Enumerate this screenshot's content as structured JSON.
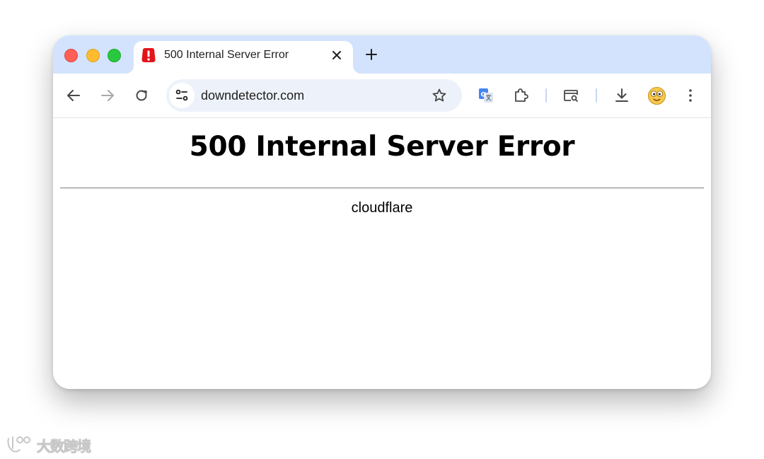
{
  "window_controls": {
    "close": "close",
    "minimize": "minimize",
    "maximize": "maximize",
    "colors": {
      "close": "#ff5f57",
      "minimize": "#febc2e",
      "maximize": "#28c840"
    }
  },
  "tab": {
    "title": "500 Internal Server Error",
    "favicon": "error-exclamation-icon",
    "favicon_color": "#e3151a"
  },
  "toolbar": {
    "back": "arrow-left-icon",
    "forward": "arrow-right-icon",
    "reload": "reload-icon",
    "url": "downdetector.com",
    "extensions": [
      "google-translate-icon",
      "extensions-puzzle-icon",
      "tab-search-icon",
      "download-icon",
      "profile-avatar-icon",
      "more-menu-icon"
    ]
  },
  "page": {
    "heading": "500 Internal Server Error",
    "server": "cloudflare"
  },
  "watermark": {
    "text": "大数跨境"
  },
  "colors": {
    "tabstrip": "#d3e3fd",
    "omnibox": "#edf2fa"
  }
}
